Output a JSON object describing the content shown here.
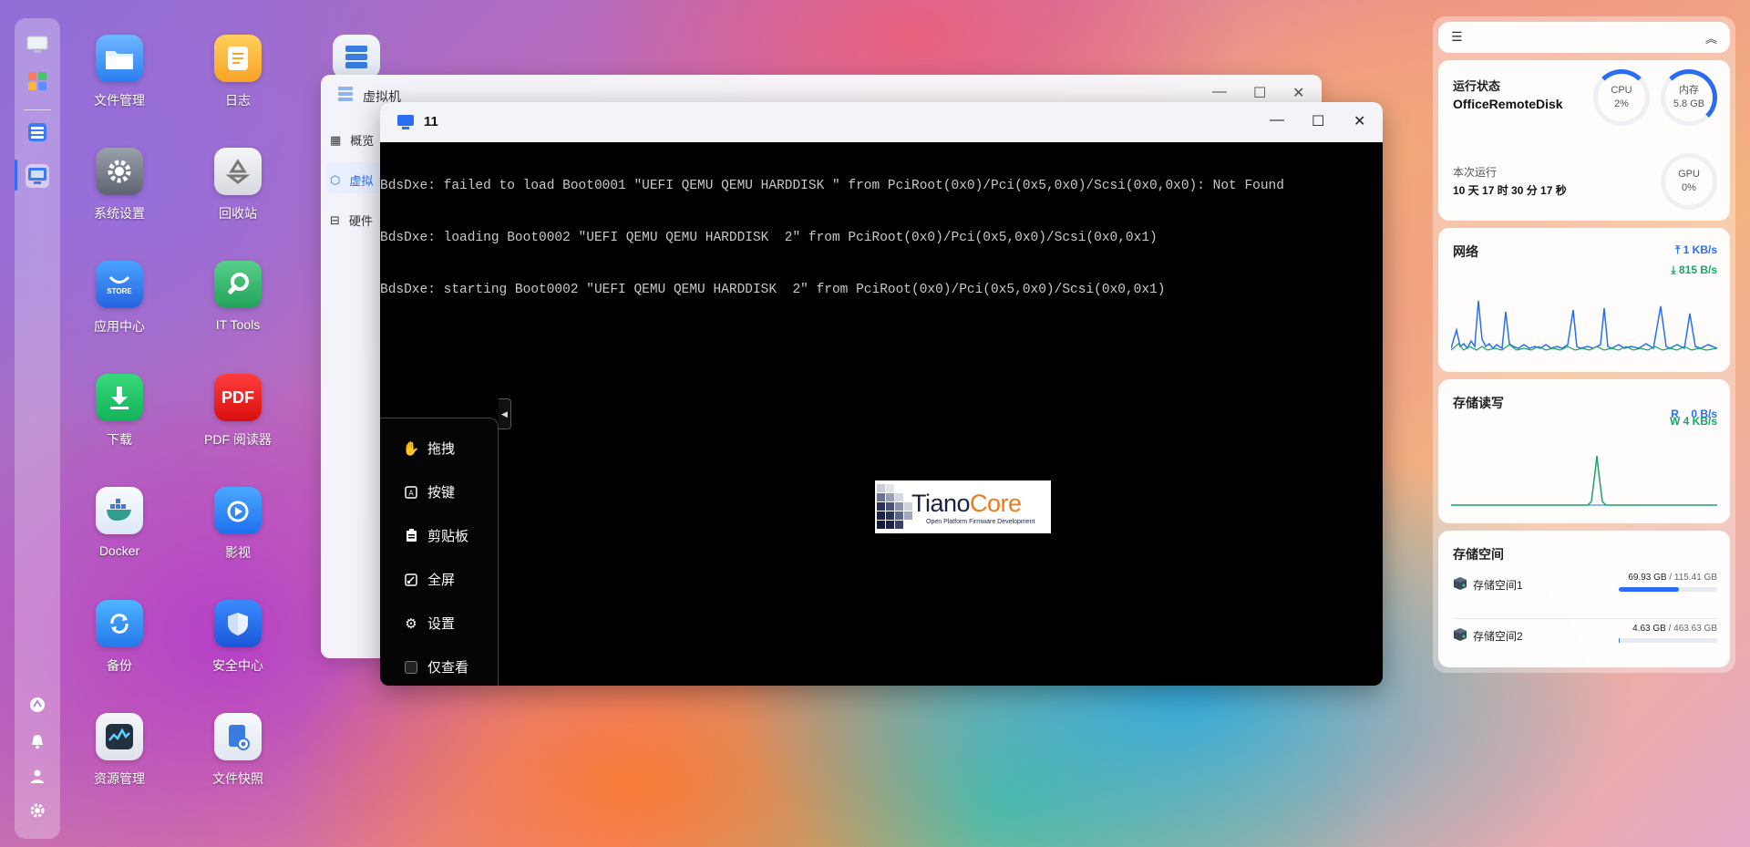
{
  "desktop": {
    "icons": [
      {
        "label": "文件管理",
        "icon": "folder-icon"
      },
      {
        "label": "日志",
        "icon": "log-icon"
      },
      {
        "label": "系统设置",
        "icon": "gear-icon"
      },
      {
        "label": "回收站",
        "icon": "recycle-icon"
      },
      {
        "label": "应用中心",
        "icon": "store-icon",
        "badge": "STORE"
      },
      {
        "label": "IT Tools",
        "icon": "tools-icon"
      },
      {
        "label": "下载",
        "icon": "download-icon"
      },
      {
        "label": "PDF 阅读器",
        "icon": "pdf-icon",
        "badge": "PDF"
      },
      {
        "label": "Docker",
        "icon": "docker-icon"
      },
      {
        "label": "影视",
        "icon": "video-icon"
      },
      {
        "label": "备份",
        "icon": "backup-icon"
      },
      {
        "label": "安全中心",
        "icon": "shield-icon"
      },
      {
        "label": "资源管理",
        "icon": "monitor-icon"
      },
      {
        "label": "文件快照",
        "icon": "snapshot-icon"
      }
    ]
  },
  "vm_window": {
    "title": "虚拟机",
    "nav": [
      "概览",
      "虚拟",
      "硬件"
    ]
  },
  "console": {
    "title": "11",
    "lines": [
      "BdsDxe: failed to load Boot0001 \"UEFI QEMU QEMU HARDDISK \" from PciRoot(0x0)/Pci(0x5,0x0)/Scsi(0x0,0x0): Not Found",
      "BdsDxe: loading Boot0002 \"UEFI QEMU QEMU HARDDISK  2\" from PciRoot(0x0)/Pci(0x5,0x0)/Scsi(0x0,0x1)",
      "BdsDxe: starting Boot0002 \"UEFI QEMU QEMU HARDDISK  2\" from PciRoot(0x0)/Pci(0x5,0x0)/Scsi(0x0,0x1)"
    ],
    "tools": [
      "拖拽",
      "按键",
      "剪贴板",
      "全屏",
      "设置",
      "仅查看"
    ],
    "logo_main": "TianoCore",
    "logo_sub": "Open Platform Firmware Development"
  },
  "widgets": {
    "status": {
      "title": "运行状态",
      "host": "OfficeRemoteDisk",
      "uptime_label": "本次运行",
      "uptime": "10 天 17 时 30 分 17 秒",
      "cpu_label": "CPU",
      "cpu_value": "2%",
      "mem_label": "内存",
      "mem_value": "5.8 GB",
      "gpu_label": "GPU",
      "gpu_value": "0%"
    },
    "network": {
      "title": "网络",
      "up": "1 KB/s",
      "down": "815 B/s"
    },
    "storage_io": {
      "title": "存储读写",
      "read_label": "R",
      "read": "0 B/s",
      "write_label": "W",
      "write": "4 KB/s"
    },
    "storage_space": {
      "title": "存储空间",
      "pools": [
        {
          "name": "存储空间1",
          "used": "69.93 GB",
          "total": "/ 115.41 GB",
          "fraction": 0.61
        },
        {
          "name": "存储空间2",
          "used": "4.63 GB",
          "total": "/ 463.63 GB",
          "fraction": 0.01
        }
      ]
    }
  },
  "colors": {
    "accent": "#2a6df4",
    "write_green": "#1aa36a"
  }
}
